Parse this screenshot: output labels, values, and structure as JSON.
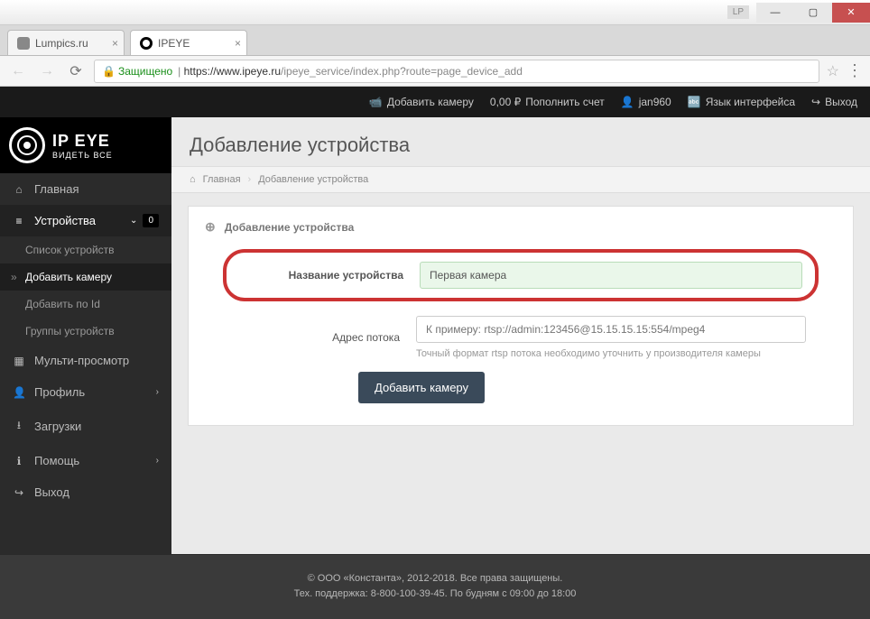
{
  "window": {
    "marker": "LP"
  },
  "tabs": [
    {
      "title": "Lumpics.ru"
    },
    {
      "title": "IPEYE"
    }
  ],
  "addressbar": {
    "secure_label": "Защищено",
    "url_host": "https://www.ipeye.ru",
    "url_path": "/ipeye_service/index.php?route=page_device_add"
  },
  "topbar": {
    "add_camera": "Добавить камеру",
    "balance": "0,00 ₽",
    "topup": "Пополнить счет",
    "user": "jan960",
    "lang": "Язык интерфейса",
    "logout": "Выход"
  },
  "logo": {
    "main": "IP EYE",
    "sub": "ВИДЕТЬ ВСЕ"
  },
  "sidebar": {
    "home": "Главная",
    "devices": "Устройства",
    "devices_badge": "0",
    "device_list": "Список устройств",
    "add_camera": "Добавить камеру",
    "add_by_id": "Добавить по Id",
    "device_groups": "Группы устройств",
    "multi": "Мульти-просмотр",
    "profile": "Профиль",
    "downloads": "Загрузки",
    "help": "Помощь",
    "logout": "Выход"
  },
  "page": {
    "title": "Добавление устройства",
    "breadcrumb_home": "Главная",
    "breadcrumb_current": "Добавление устройства"
  },
  "card": {
    "head": "Добавление устройства",
    "name_label": "Название устройства",
    "name_value": "Первая камера",
    "stream_label": "Адрес потока",
    "stream_placeholder": "К примеру: rtsp://admin:123456@15.15.15.15:554/mpeg4",
    "stream_hint": "Точный формат rtsp потока необходимо уточнить у производителя камеры",
    "submit": "Добавить камеру"
  },
  "footer": {
    "line1": "© ООО «Константа», 2012-2018. Все права защищены.",
    "line2": "Тех. поддержка: 8-800-100-39-45. По будням с 09:00 до 18:00"
  }
}
